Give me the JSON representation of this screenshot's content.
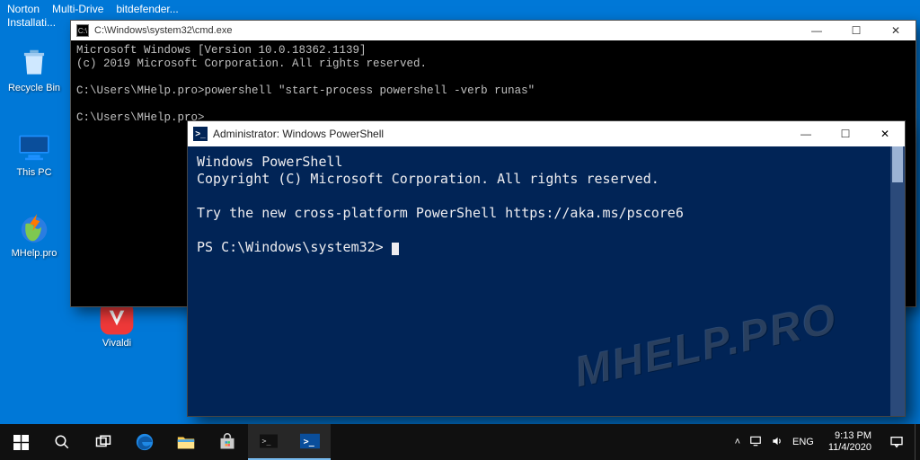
{
  "top_tasks": {
    "t0": "Norton",
    "t1": "Multi-Drive",
    "t2": "bitdefender..."
  },
  "top_tasks2": "Installati...",
  "desktop": {
    "recycle": "Recycle Bin",
    "thispc": "This PC",
    "mhelp": "MHelp.pro",
    "vivaldi": "Vivaldi"
  },
  "cmd": {
    "title": "C:\\Windows\\system32\\cmd.exe",
    "line1": "Microsoft Windows [Version 10.0.18362.1139]",
    "line2": "(c) 2019 Microsoft Corporation. All rights reserved.",
    "line3": "C:\\Users\\MHelp.pro>powershell \"start-process powershell -verb runas\"",
    "line4": "C:\\Users\\MHelp.pro>"
  },
  "ps": {
    "title": "Administrator: Windows PowerShell",
    "line1": "Windows PowerShell",
    "line2": "Copyright (C) Microsoft Corporation. All rights reserved.",
    "line3": "Try the new cross-platform PowerShell https://aka.ms/pscore6",
    "prompt": "PS C:\\Windows\\system32> "
  },
  "watermark": "MHELP.PRO",
  "tray": {
    "lang": "ENG"
  },
  "clock": {
    "time": "9:13 PM",
    "date": "11/4/2020"
  },
  "winbtn": {
    "min": "—",
    "max": "☐",
    "close": "✕"
  }
}
